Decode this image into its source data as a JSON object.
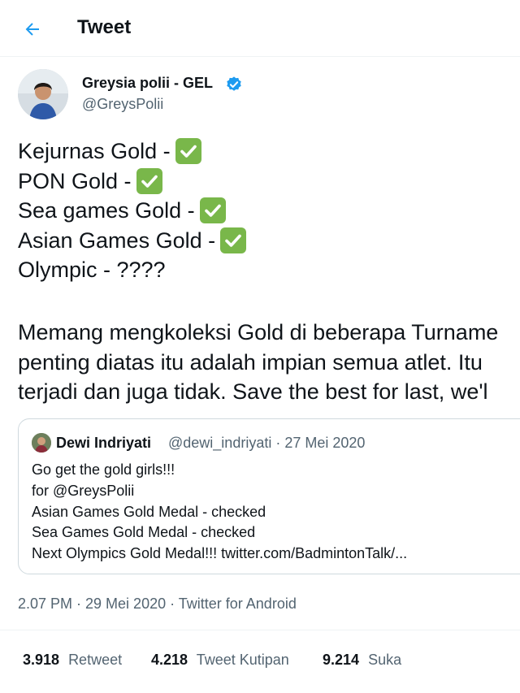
{
  "header": {
    "title": "Tweet"
  },
  "author": {
    "name": "Greysia polii - GEL",
    "handle": "@GreysPolii"
  },
  "tweet": {
    "lines": [
      {
        "text": "Kejurnas Gold - ",
        "check": true
      },
      {
        "text": "PON Gold - ",
        "check": true
      },
      {
        "text": "Sea games Gold - ",
        "check": true
      },
      {
        "text": "Asian Games Gold - ",
        "check": true
      },
      {
        "text": "Olympic - ????",
        "check": false
      }
    ],
    "paragraph": [
      "Memang mengkoleksi Gold di beberapa Turname",
      "penting diatas itu adalah impian semua atlet. Itu",
      "terjadi dan juga tidak. Save the best for last, we'l"
    ]
  },
  "quote": {
    "name": "Dewi Indriyati",
    "handle_date": "@dewi_indriyati · 27 Mei 2020",
    "lines": [
      "Go get the gold girls!!!",
      "for @GreysPolii",
      "Asian Games Gold Medal - checked",
      "Sea Games Gold Medal - checked",
      "Next Olympics Gold Medal!!! twitter.com/BadmintonTalk/..."
    ]
  },
  "meta": {
    "timestamp": "2.07 PM · 29 Mei 2020 · Twitter for Android"
  },
  "stats": [
    {
      "count": "3.918",
      "label": "Retweet"
    },
    {
      "count": "4.218",
      "label": "Tweet Kutipan"
    },
    {
      "count": "9.214",
      "label": "Suka"
    }
  ],
  "colors": {
    "accent": "#1d9bf0",
    "check_green": "#79b74a",
    "secondary_text": "#536471",
    "primary_text": "#0f1419"
  }
}
